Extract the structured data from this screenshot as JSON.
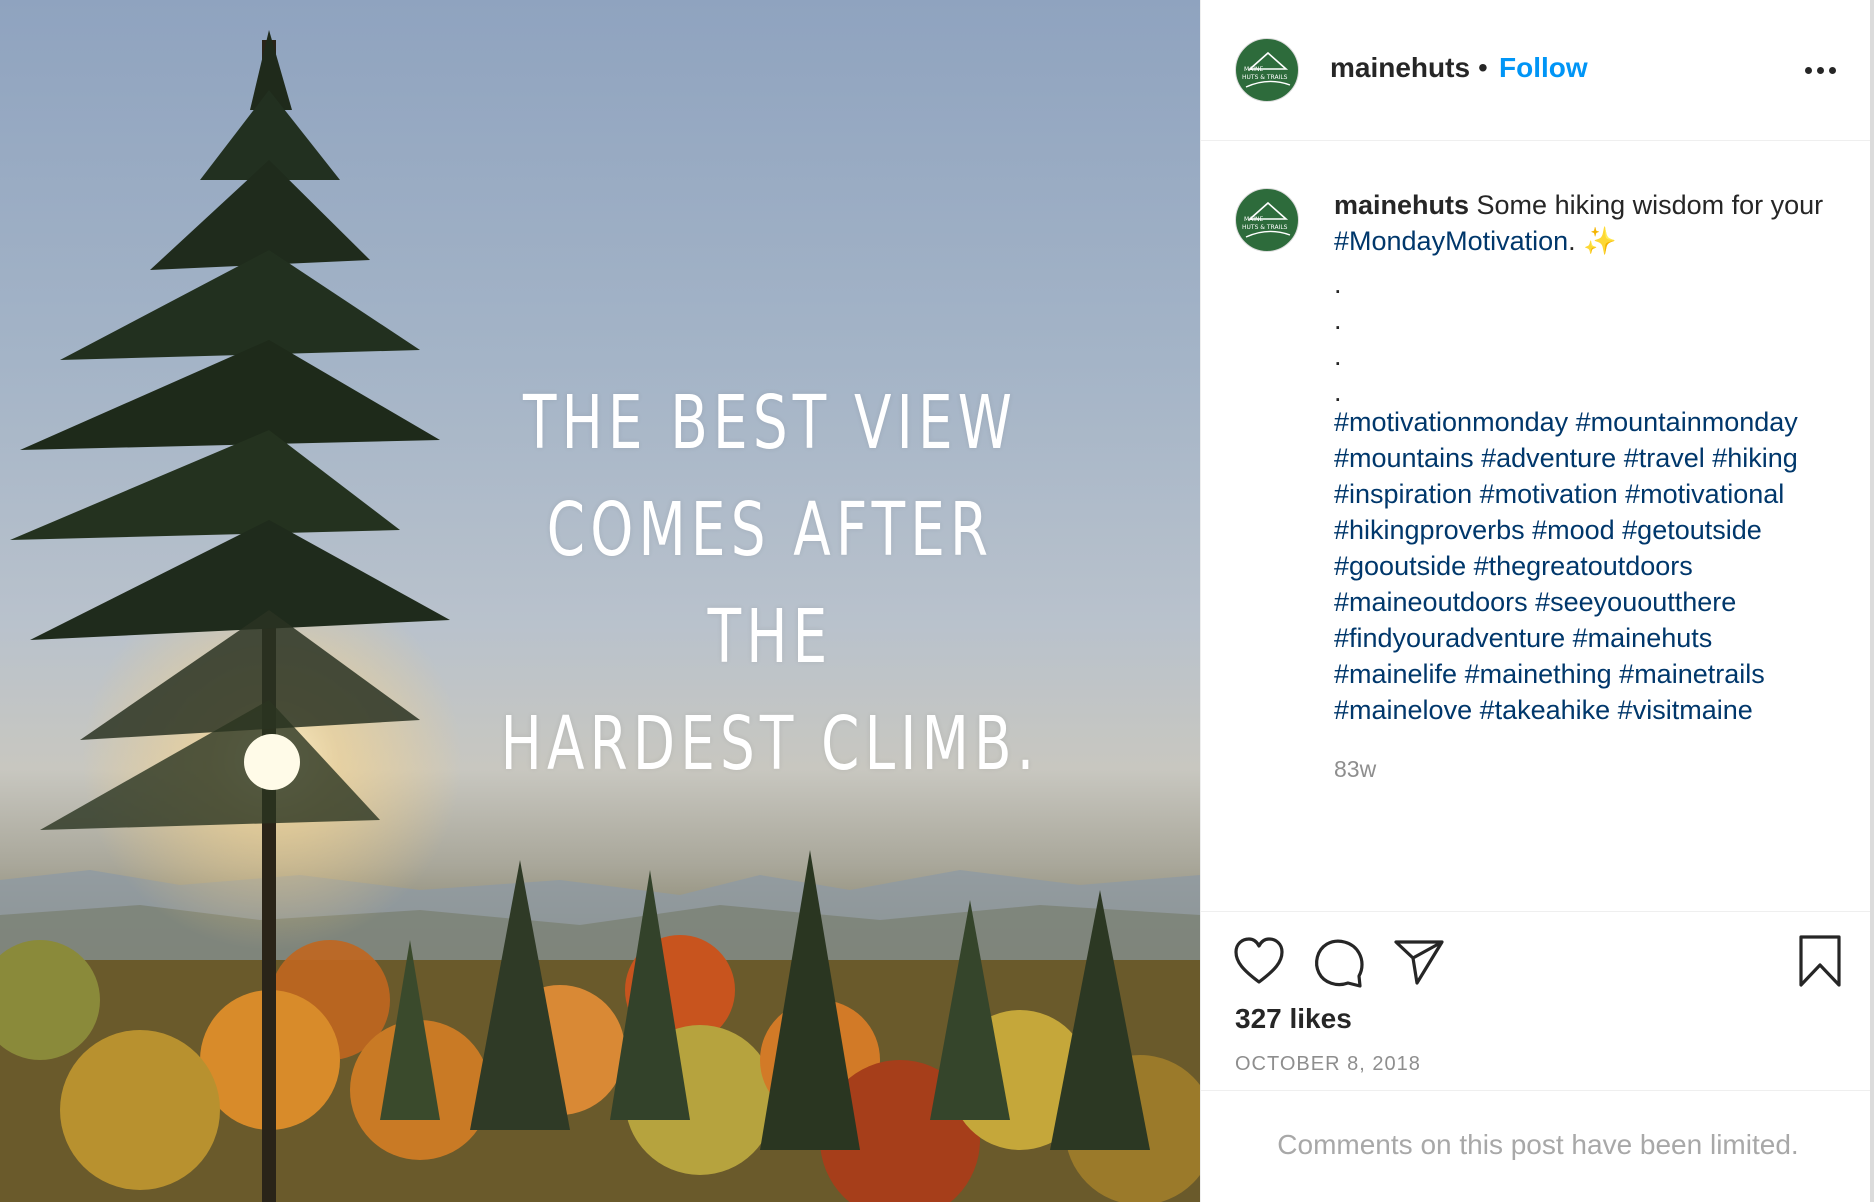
{
  "post_image": {
    "quote_lines": [
      "THE BEST VIEW",
      "COMES AFTER THE",
      "HARDEST CLIMB."
    ]
  },
  "header": {
    "username": "mainehuts",
    "separator": "•",
    "follow_label": "Follow",
    "avatar_text_1": "MAINE",
    "avatar_text_2": "HUTS & TRAILS"
  },
  "caption": {
    "username": "mainehuts",
    "text": " Some hiking wisdom for your ",
    "hashtag": "#MondayMotivation",
    "suffix": ". ✨",
    "dots": [
      ".",
      ".",
      ".",
      "."
    ],
    "hashtag_lines": [
      "#motivationmonday #mountainmonday",
      "#mountains #adventure #travel #hiking",
      "#inspiration #motivation #motivational",
      "#hikingproverbs #mood #getoutside",
      "#gooutside #thegreatoutdoors",
      "#maineoutdoors #seeyououtthere",
      "#findyouradventure #mainehuts",
      "#mainelife #mainething #mainetrails",
      "#mainelove #takeahike #visitmaine"
    ],
    "age": "83w"
  },
  "actions": {
    "like_icon": "heart-icon",
    "comment_icon": "comment-icon",
    "share_icon": "paper-plane-icon",
    "save_icon": "bookmark-icon"
  },
  "likes": "327 likes",
  "date": "OCTOBER 8, 2018",
  "comments_notice": "Comments on this post have been limited.",
  "colors": {
    "follow": "#0095f6",
    "hashtag": "#00376b",
    "muted": "#8e8e8e",
    "avatar_bg": "#2d6b3b"
  }
}
